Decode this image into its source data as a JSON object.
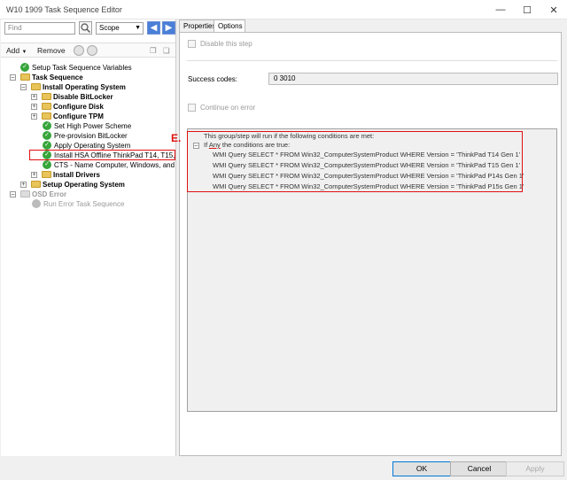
{
  "window": {
    "title": "W10 1909 Task Sequence Editor"
  },
  "search": {
    "placeholder": "Find",
    "scope": "Scope"
  },
  "toolbar": {
    "add": "Add",
    "remove": "Remove"
  },
  "tree": [
    {
      "label": "Setup Task Sequence Variables",
      "state": "ok"
    },
    {
      "label": "Task Sequence",
      "state": "group",
      "bold": true
    },
    {
      "label": "Install Operating System",
      "state": "group",
      "bold": true
    },
    {
      "label": "Disable BitLocker",
      "state": "group",
      "bold": true
    },
    {
      "label": "Configure Disk",
      "state": "group",
      "bold": true
    },
    {
      "label": "Configure TPM",
      "state": "group",
      "bold": true
    },
    {
      "label": "Set High Power Scheme",
      "state": "ok"
    },
    {
      "label": "Pre-provision BitLocker",
      "state": "ok"
    },
    {
      "label": "Apply Operating System",
      "state": "ok"
    },
    {
      "label": "Install HSA Offline ThinkPad T14, T15, P",
      "state": "ok",
      "selected": true
    },
    {
      "label": "CTS - Name Computer, Windows, and Ne",
      "state": "ok"
    },
    {
      "label": "Install Drivers",
      "state": "group",
      "bold": true
    },
    {
      "label": "Setup Operating System",
      "state": "group",
      "bold": true
    },
    {
      "label": "OSD Error",
      "state": "group-disabled",
      "bold": true
    },
    {
      "label": "Run Error Task Sequence",
      "state": "disabled"
    }
  ],
  "tabs": [
    "Properties",
    "Options"
  ],
  "options": {
    "disable_step": "Disable this step",
    "success_codes_label": "Success codes:",
    "success_codes_value": "0 3010",
    "continue_on_error": "Continue on error",
    "conditions_header": "This group/step will run if the following conditions are met:",
    "if_prefix": "If",
    "if_any": "Any",
    "if_suffix": "the conditions are true:",
    "conditions": [
      "WMI Query  SELECT * FROM Win32_ComputerSystemProduct WHERE Version = 'ThinkPad T14 Gen 1'",
      "WMI Query  SELECT * FROM Win32_ComputerSystemProduct WHERE Version = 'ThinkPad T15 Gen 1'",
      "WMI Query  SELECT * FROM Win32_ComputerSystemProduct WHERE Version = 'ThinkPad P14s Gen 1'",
      "WMI Query  SELECT * FROM Win32_ComputerSystemProduct WHERE Version = 'ThinkPad P15s Gen 1'"
    ]
  },
  "annotation": {
    "label": "E."
  },
  "footer": {
    "ok": "OK",
    "cancel": "Cancel",
    "apply": "Apply"
  },
  "colors": {
    "highlight": "#e01010",
    "check": "#37a53b",
    "accent": "#0078d7"
  }
}
